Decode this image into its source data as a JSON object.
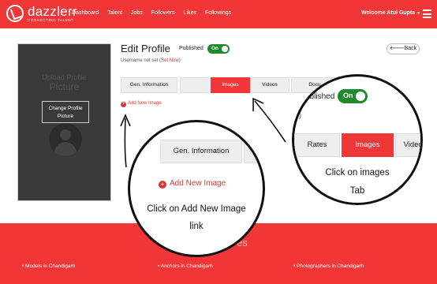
{
  "nav": {
    "brand": "dazzlerr",
    "tagline": "CONNECTING TALENT",
    "links": [
      "Dashboard",
      "Talent",
      "Jobs",
      "Followers",
      "Likes",
      "Followings"
    ],
    "welcome": "Welcome Atul Gupta"
  },
  "profile_picture": {
    "upload_line1": "Upload Profile",
    "upload_line2": "Picture",
    "change_button": "Change Profile Picture"
  },
  "edit": {
    "title": "Edit Profile",
    "published_label": "Published",
    "toggle_label": "On",
    "username_note": "Username not set (",
    "set_now": "Set Now",
    "username_close": ")",
    "back_label": "Back",
    "tabs": [
      "Gen. Information",
      "Rates",
      "Images",
      "Videos",
      "Docu",
      ""
    ],
    "add_image": "Add New Image"
  },
  "footer": {
    "title": "es",
    "links": [
      "Models in Chandigarh",
      "Anchors in Chandigarh",
      "Photographers in Chandigarh"
    ]
  },
  "callout_left": {
    "tab": "Gen. Information",
    "add_image": "Add New Image",
    "caption_line1": "Click  on Add New Image",
    "caption_line2": "link"
  },
  "callout_right": {
    "published_fragment": "ublished",
    "toggle_label": "On",
    "paren": ")",
    "tabs": [
      "Rates",
      "Images",
      "Videos"
    ],
    "caption_line1": "Click  on images",
    "caption_line2": "Tab"
  },
  "colors": {
    "brand_red": "#f03636",
    "toggle_green": "#1e8a2c"
  }
}
